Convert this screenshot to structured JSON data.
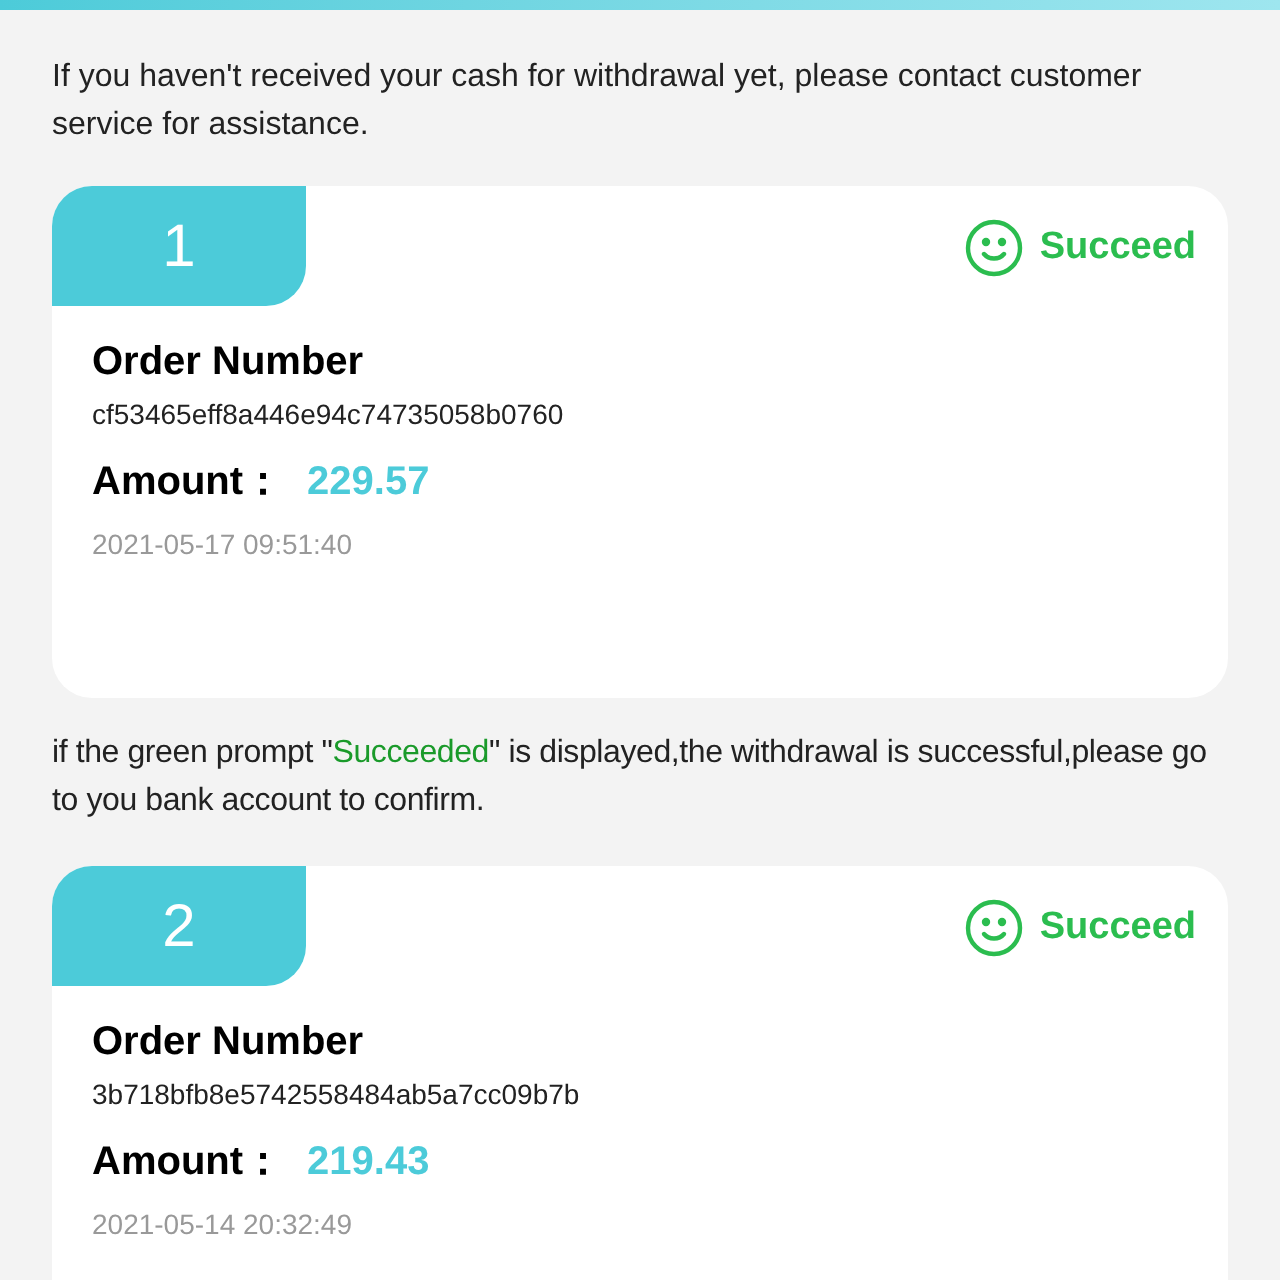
{
  "notices": [
    {
      "before": "If you haven't received your cash for withdrawal yet, please contact customer service for assistance."
    },
    {
      "before": "if the green prompt \"",
      "highlight": "Succeeded",
      "after": "\" is displayed,the withdrawal is successful,please go to you bank account to confirm."
    }
  ],
  "orders": [
    {
      "index": "1",
      "kind": "success",
      "status_label": "Succeed",
      "order_label": "Order Number",
      "order_number": "cf53465eff8a446e94c74735058b0760",
      "amount_label": "Amount：",
      "amount": "229.57",
      "time": "2021-05-17 09:51:40"
    },
    {
      "index": "2",
      "kind": "success",
      "status_label": "Succeed",
      "order_label": "Order Number",
      "order_number": "3b718bfb8e5742558484ab5a7cc09b7b",
      "amount_label": "Amount：",
      "amount": "219.43",
      "time": "2021-05-14 20:32:49"
    }
  ]
}
